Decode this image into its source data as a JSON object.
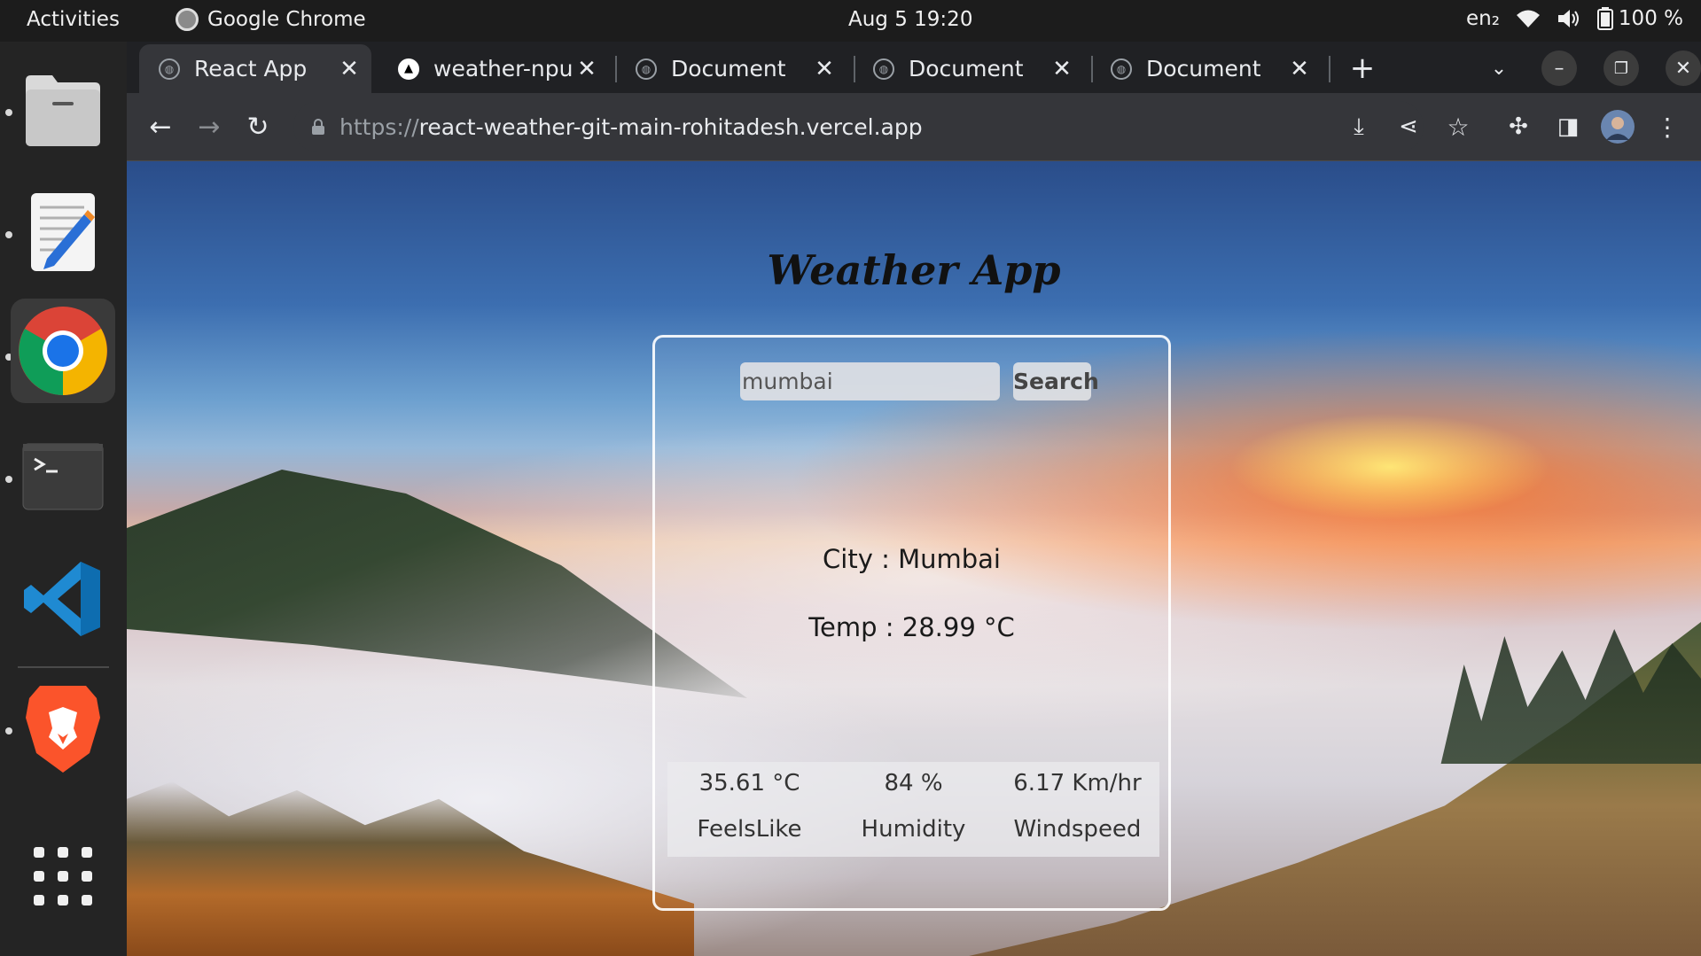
{
  "system_bar": {
    "activities": "Activities",
    "app_name": "Google Chrome",
    "clock": "Aug 5  19:20",
    "input_method": "en₂",
    "battery": "100 %"
  },
  "dock": {
    "items": [
      "files",
      "text-editor",
      "google-chrome",
      "terminal",
      "vscode",
      "brave",
      "show-apps"
    ]
  },
  "browser": {
    "tabs": [
      {
        "title": "React App",
        "active": true
      },
      {
        "title": "weather-npu",
        "active": false
      },
      {
        "title": "Document",
        "active": false
      },
      {
        "title": "Document",
        "active": false
      },
      {
        "title": "Document",
        "active": false
      }
    ],
    "url": {
      "scheme": "https://",
      "host": "react-weather-git-main-rohitadesh.vercel.app"
    }
  },
  "app": {
    "title": "Weather App",
    "search": {
      "value": "mumbai",
      "button_label": "Search"
    },
    "city_line": "City : Mumbai",
    "temp_line": "Temp : 28.99 °C",
    "stats": [
      {
        "value": "35.61 °C",
        "label": "FeelsLike"
      },
      {
        "value": "84 %",
        "label": "Humidity"
      },
      {
        "value": "6.17 Km/hr",
        "label": "Windspeed"
      }
    ]
  },
  "colors": {
    "system_bar": "#1c1c1c",
    "dock": "#242424",
    "tabstrip": "#202124",
    "toolbar": "#35363a"
  }
}
